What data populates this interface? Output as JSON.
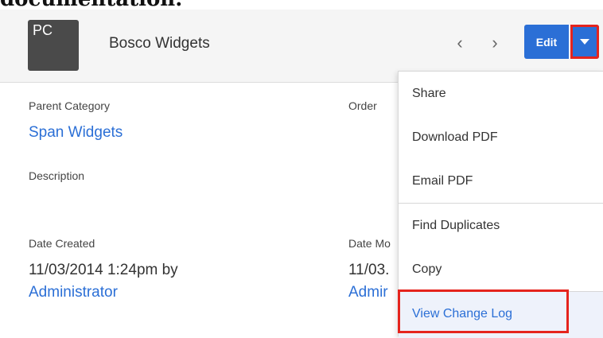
{
  "doc_heading": "documentation.",
  "header": {
    "avatar_text": "PC",
    "title": "Bosco Widgets",
    "prev_arrow": "‹",
    "next_arrow": "›",
    "edit_label": "Edit",
    "colors": {
      "primary": "#2b6fd6",
      "highlight": "#e5241d"
    }
  },
  "fields": {
    "parent_category": {
      "label": "Parent Category",
      "value": "Span Widgets"
    },
    "order": {
      "label": "Order"
    },
    "description": {
      "label": "Description"
    },
    "date_created": {
      "label": "Date Created",
      "value": "11/03/2014 1:24pm by",
      "user": "Administrator"
    },
    "date_modified": {
      "label": "Date Mo",
      "value": "11/03.",
      "user": "Admir"
    }
  },
  "menu": {
    "items": [
      {
        "label": "Share"
      },
      {
        "label": "Download PDF"
      },
      {
        "label": "Email PDF"
      },
      {
        "label": "Find Duplicates"
      },
      {
        "label": "Copy"
      },
      {
        "label": "View Change Log"
      }
    ]
  }
}
